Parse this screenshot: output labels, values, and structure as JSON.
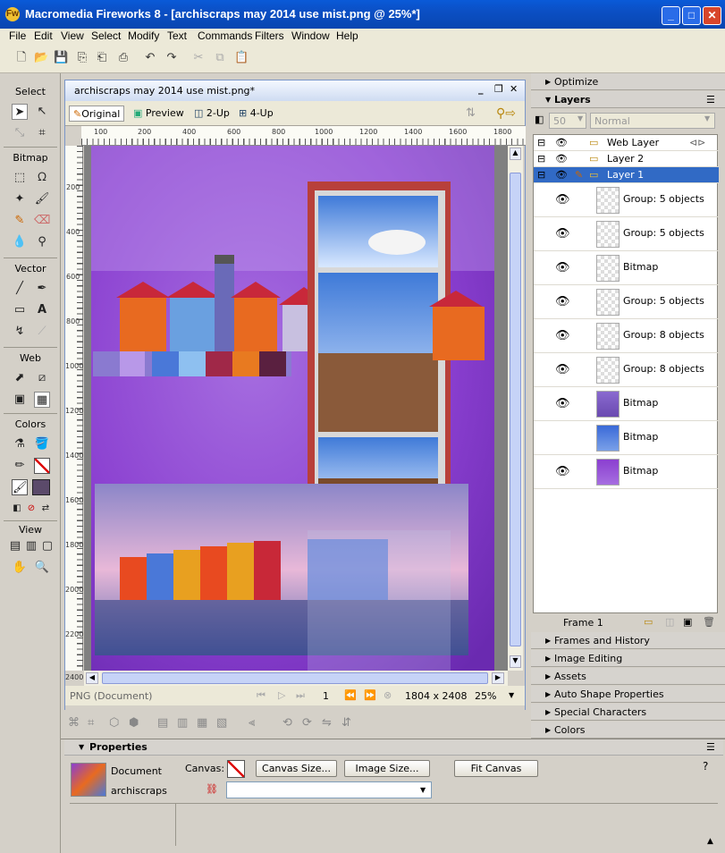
{
  "window": {
    "title": "Macromedia Fireworks 8 - [archiscraps may 2014 use mist.png @  25%*]",
    "app_icon": "fireworks-icon"
  },
  "menu": [
    "File",
    "Edit",
    "View",
    "Select",
    "Modify",
    "Text",
    "Commands",
    "Filters",
    "Window",
    "Help"
  ],
  "tools": {
    "select": "Select",
    "bitmap": "Bitmap",
    "vector": "Vector",
    "web": "Web",
    "colors": "Colors",
    "view": "View"
  },
  "document": {
    "tab_title": "archiscraps may 2014 use mist.png*",
    "views": [
      "Original",
      "Preview",
      "2-Up",
      "4-Up"
    ],
    "ruler_top": [
      "100",
      "200",
      "400",
      "600",
      "800",
      "1000",
      "1200",
      "1400",
      "1600",
      "1800"
    ],
    "ruler_left": [
      "200",
      "400",
      "600",
      "800",
      "1000",
      "1200",
      "1400",
      "1600",
      "1800",
      "2000",
      "2200",
      "2400"
    ],
    "status_type": "PNG (Document)",
    "frame": "1",
    "size": "1804 x 2408",
    "zoom": "25%"
  },
  "panels": {
    "optimize": "Optimize",
    "layers": "Layers",
    "opacity": "50",
    "blend": "Normal",
    "groups": [
      "Web Layer",
      "Layer 2",
      "Layer 1"
    ],
    "objects": [
      {
        "name": "Group: 5 objects",
        "visible": true
      },
      {
        "name": "Group: 5 objects",
        "visible": true
      },
      {
        "name": "Bitmap",
        "visible": true
      },
      {
        "name": "Group: 5 objects",
        "visible": true
      },
      {
        "name": "Group: 8 objects",
        "visible": true
      },
      {
        "name": "Group: 8 objects",
        "visible": true
      },
      {
        "name": "Bitmap",
        "visible": true
      },
      {
        "name": "Bitmap",
        "visible": false
      },
      {
        "name": "Bitmap",
        "visible": true
      }
    ],
    "frame_label": "Frame 1",
    "collapsed": [
      "Frames and History",
      "Image Editing",
      "Assets",
      "Auto Shape Properties",
      "Special Characters",
      "Colors"
    ]
  },
  "properties": {
    "title": "Properties",
    "doc_type": "Document",
    "doc_name": "archiscraps",
    "canvas_label": "Canvas:",
    "canvas_size_btn": "Canvas Size...",
    "image_size_btn": "Image Size...",
    "fit_canvas_btn": "Fit Canvas"
  },
  "colors": {
    "accent": "#0a5ad8",
    "selection": "#316ac5",
    "canvas_purple": "#8a3fd0"
  }
}
